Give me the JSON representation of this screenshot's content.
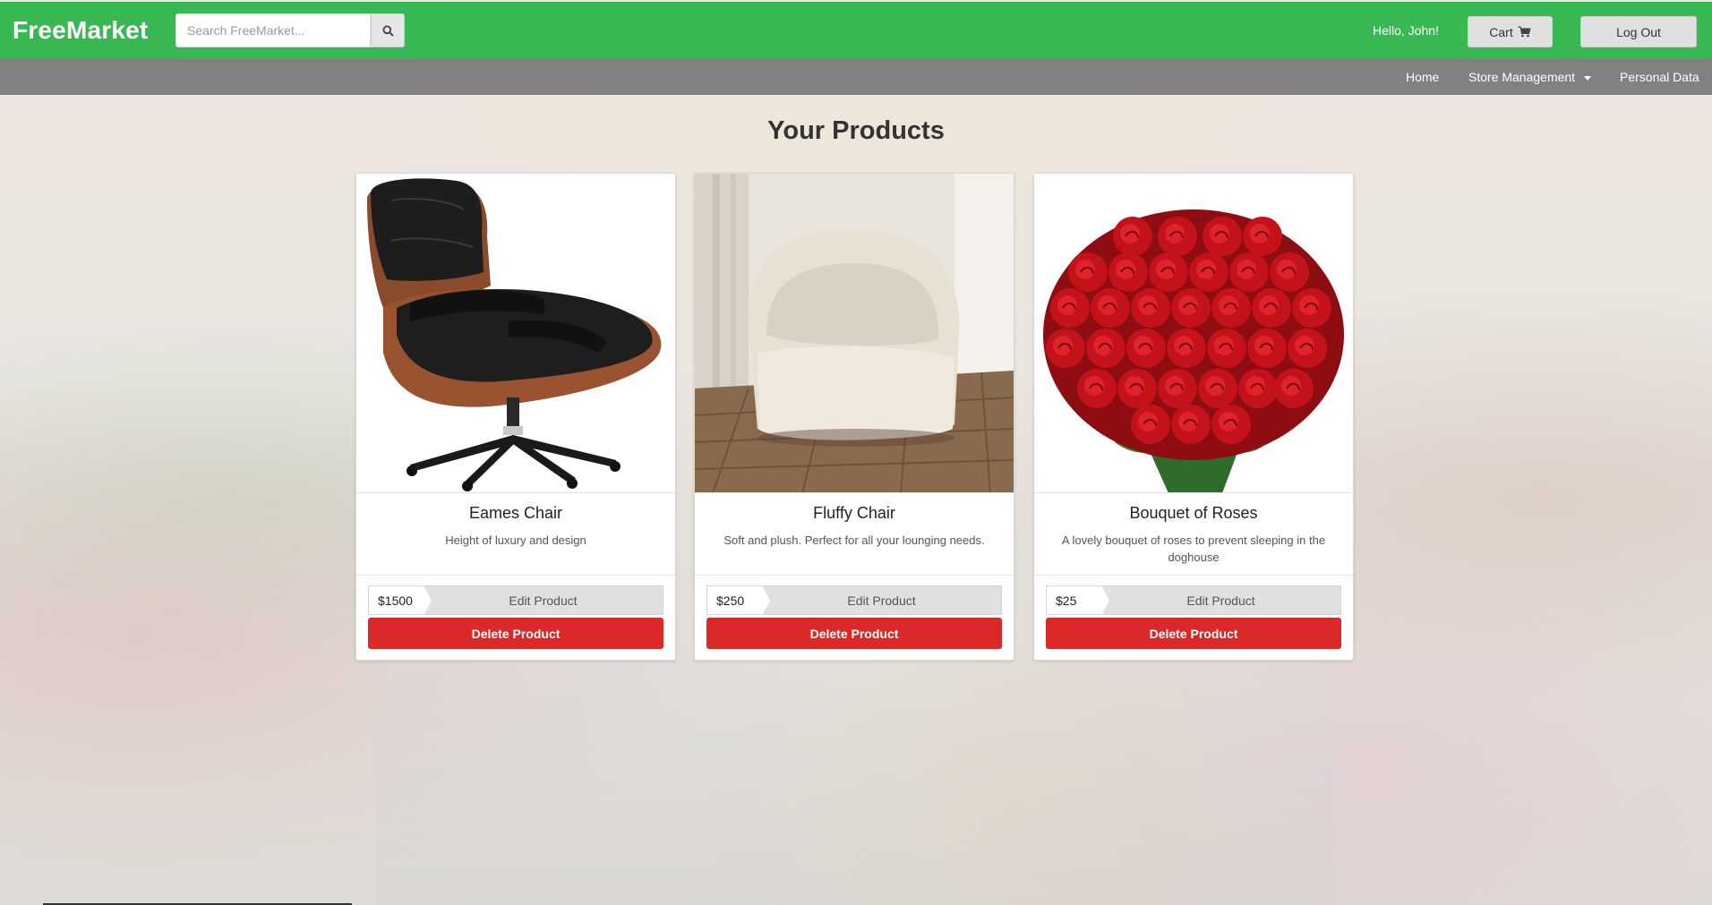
{
  "header": {
    "brand": "FreeMarket",
    "search_placeholder": "Search FreeMarket...",
    "greeting": "Hello, John!",
    "cart_label": "Cart",
    "logout_label": "Log Out"
  },
  "subnav": {
    "home": "Home",
    "store_management": "Store Management",
    "personal_data": "Personal Data"
  },
  "page": {
    "title": "Your Products"
  },
  "products": [
    {
      "name": "Eames Chair",
      "description": "Height of luxury and design",
      "price": "$1500",
      "edit_label": "Edit Product",
      "delete_label": "Delete Product"
    },
    {
      "name": "Fluffy Chair",
      "description": "Soft and plush. Perfect for all your lounging needs.",
      "price": "$250",
      "edit_label": "Edit Product",
      "delete_label": "Delete Product"
    },
    {
      "name": "Bouquet of Roses",
      "description": "A lovely bouquet of roses to prevent sleeping in the doghouse",
      "price": "$25",
      "edit_label": "Edit Product",
      "delete_label": "Delete Product"
    }
  ],
  "colors": {
    "navbar": "#28b446",
    "danger": "#db2828"
  },
  "icons": {
    "search": "search-icon",
    "cart": "cart-icon",
    "dropdown": "caret-down-icon"
  }
}
